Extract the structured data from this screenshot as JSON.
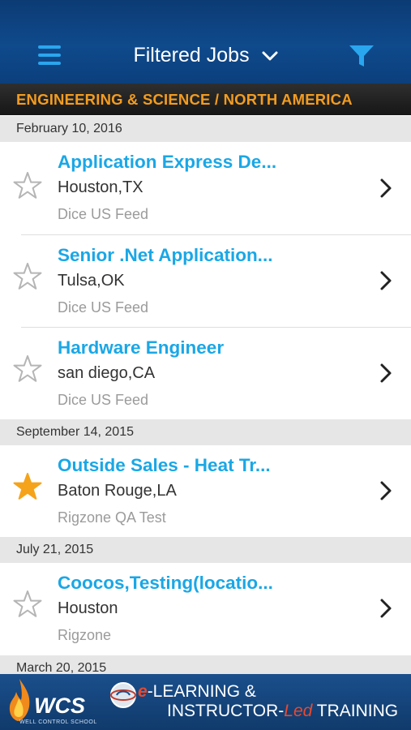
{
  "header": {
    "title": "Filtered Jobs"
  },
  "section": {
    "label": "ENGINEERING & SCIENCE / NORTH AMERICA"
  },
  "dates": [
    "February 10, 2016",
    "September 14, 2015",
    "July 21, 2015",
    "March 20, 2015"
  ],
  "jobs": [
    {
      "title": "Application Express De...",
      "location": "Houston,TX",
      "source": "Dice US Feed",
      "starred": false
    },
    {
      "title": "Senior .Net Application...",
      "location": "Tulsa,OK",
      "source": "Dice US Feed",
      "starred": false
    },
    {
      "title": "Hardware Engineer",
      "location": "san diego,CA",
      "source": "Dice US Feed",
      "starred": false
    },
    {
      "title": "Outside Sales - Heat Tr...",
      "location": "Baton Rouge,LA",
      "source": "Rigzone QA Test",
      "starred": true
    },
    {
      "title": "Coocos,Testing(locatio...",
      "location": "Houston",
      "source": "Rigzone",
      "starred": false
    }
  ],
  "banner": {
    "logo": "WCS",
    "logo_sub": "WELL CONTROL SCHOOL",
    "line1_prefix": "e",
    "line1_rest": "-LEARNING &",
    "line2_a": "INSTRUCTOR-",
    "line2_led": "Led",
    "line2_b": " TRAINING"
  },
  "colors": {
    "accent": "#1aa7e6",
    "section_text": "#f39c1f",
    "star_filled": "#f5a31a",
    "header_bg": "#0f4a8c"
  },
  "icons": {
    "menu": "hamburger-icon",
    "filter": "funnel-icon",
    "dropdown": "chevron-down-icon",
    "row": "chevron-right-icon",
    "star": "star-icon"
  }
}
